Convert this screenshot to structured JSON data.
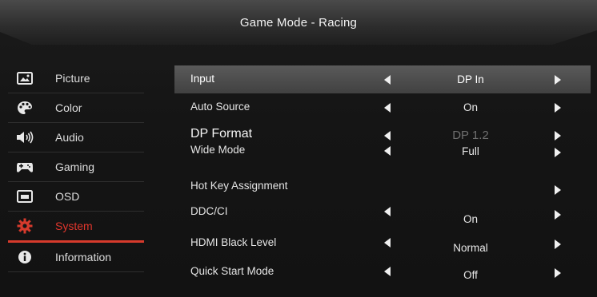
{
  "header": {
    "title": "Game Mode - Racing"
  },
  "sidebar": {
    "items": [
      {
        "label": "Picture",
        "icon": "picture-icon"
      },
      {
        "label": "Color",
        "icon": "palette-icon"
      },
      {
        "label": "Audio",
        "icon": "speaker-icon"
      },
      {
        "label": "Gaming",
        "icon": "gamepad-icon"
      },
      {
        "label": "OSD",
        "icon": "osd-icon"
      },
      {
        "label": "System",
        "icon": "gear-icon",
        "active": true
      },
      {
        "label": "Information",
        "icon": "info-icon"
      }
    ]
  },
  "settings": {
    "rows": [
      {
        "name": "Input",
        "value": "DP In",
        "selected": true
      },
      {
        "name": "Auto Source",
        "value": "On"
      },
      {
        "name": "DP Format",
        "value": "DP 1.2",
        "disabled": true
      },
      {
        "name": "Wide Mode",
        "value": "Full"
      },
      {
        "name": "Hot Key Assignment",
        "value": ""
      },
      {
        "name": "DDC/CI",
        "value": "On"
      },
      {
        "name": "HDMI Black Level",
        "value": "Normal"
      },
      {
        "name": "Quick Start Mode",
        "value": "Off"
      }
    ]
  },
  "colors": {
    "accent": "#d63a2c",
    "highlight_row": "#4a4a4a",
    "background": "#121212"
  }
}
